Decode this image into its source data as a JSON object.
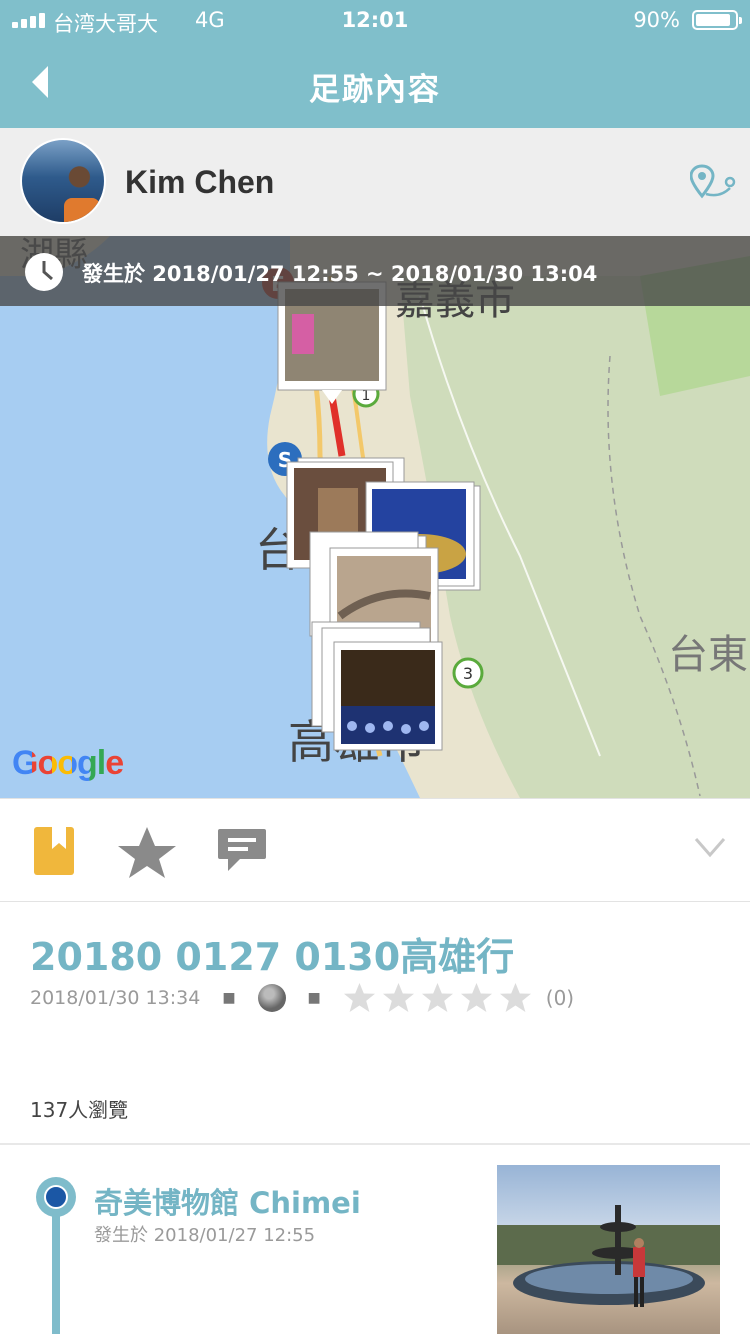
{
  "status_bar": {
    "carrier": "台湾大哥大",
    "network": "4G",
    "time": "12:01",
    "battery": "90%",
    "battery_level": 0.9
  },
  "nav": {
    "title": "足跡內容"
  },
  "user": {
    "name": "Kim Chen"
  },
  "map": {
    "time_range": "發生於 2018/01/27 12:55 ~ 2018/01/30 13:04",
    "labels": [
      "湖縣",
      "嘉義市",
      "台",
      "台東",
      "高雄市"
    ],
    "attribution": "Google",
    "markers": {
      "start": "S",
      "end": "E",
      "route_1": "1",
      "route_3": "3"
    }
  },
  "actions": [
    "bookmark-icon",
    "star-icon",
    "comment-icon",
    "chevron-down-icon"
  ],
  "trip": {
    "title": "20180 0127 0130高雄行",
    "date": "2018/01/30 13:34",
    "rating_count": "(0)",
    "rating_stars": 0,
    "views": "137人瀏覽"
  },
  "footprints": [
    {
      "name": "奇美博物館 Chimei",
      "time": "發生於 2018/01/27 12:55"
    }
  ],
  "colors": {
    "bar": "#80bfcb",
    "accent_text": "#74b5c5",
    "bookmark": "#f0b73c",
    "timeline": "#7fbccb"
  }
}
